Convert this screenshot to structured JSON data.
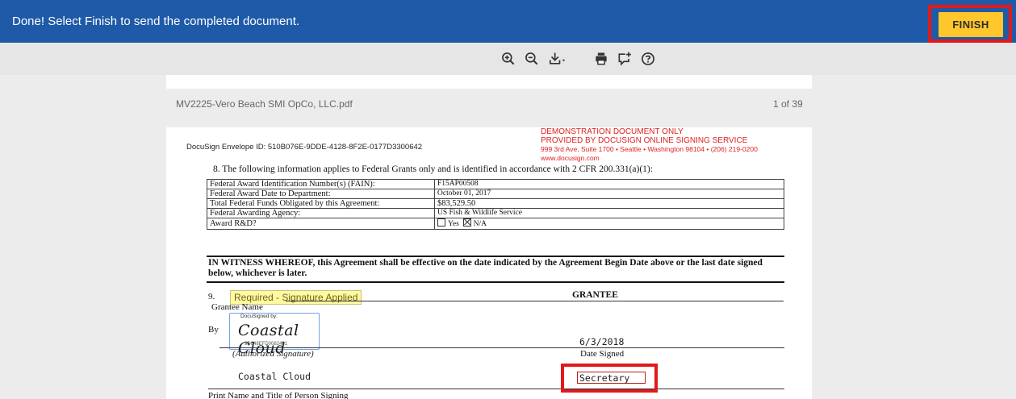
{
  "banner": {
    "message": "Done! Select Finish to send the completed document.",
    "finish_label": "FINISH"
  },
  "toolbar": {
    "tools": [
      "zoom-in-icon",
      "zoom-out-icon",
      "download-icon",
      "print-icon",
      "comment-icon",
      "help-icon"
    ]
  },
  "viewer": {
    "filename": "MV2225-Vero Beach SMI OpCo, LLC.pdf",
    "page_count": "1 of 39"
  },
  "document": {
    "envelope_id": "DocuSign Envelope ID: 510B076E-9DDE-4128-8F2E-0177D3300642",
    "demo_line1": "DEMONSTRATION DOCUMENT ONLY",
    "demo_line2": "PROVIDED BY DOCUSIGN ONLINE SIGNING SERVICE",
    "demo_line3": "999 3rd Ave, Suite 1700  • Seattle • Washington 98104 • (206) 219-0200",
    "demo_line4": "www.docusign.com",
    "section8": "8.   The following information applies to Federal Grants only and is identified in accordance with 2 CFR 200.331(a)(1):",
    "award_rows": [
      {
        "label": "Federal Award Identification Number(s) (FAIN):",
        "value": "F15AP00508"
      },
      {
        "label": "Federal Award Date to Department:",
        "value": "October 01, 2017"
      },
      {
        "label": "Total Federal Funds Obligated by this Agreement:",
        "value": "$83,529.50"
      },
      {
        "label": "Federal Awarding Agency:",
        "value": "US Fish & Wildlife Service"
      },
      {
        "label": "Award R&D?",
        "value": ""
      }
    ],
    "rd_yes": "Yes",
    "rd_na": "N/A",
    "witness": "IN WITNESS WHEREOF, this Agreement shall be effective on the date indicated by the Agreement Begin Date above or the last date signed below, whichever is later.",
    "section9": "9.",
    "required_tag": "Required - Signature Applied",
    "grantee_header": "GRANTEE",
    "grantee_name_label": "Grantee Name",
    "by_label": "By",
    "signature_docusigned": "DocuSigned by:",
    "signature_text": "Coastal Cloud",
    "signature_id": "9D648EFD0082481",
    "authorized_label": "(Authorized Signature)",
    "date_value": "6/3/2018",
    "date_label": "Date Signed",
    "print_name": "Coastal Cloud",
    "title_value": "Secretary",
    "print_label": "Print Name and Title of Person Signing"
  }
}
